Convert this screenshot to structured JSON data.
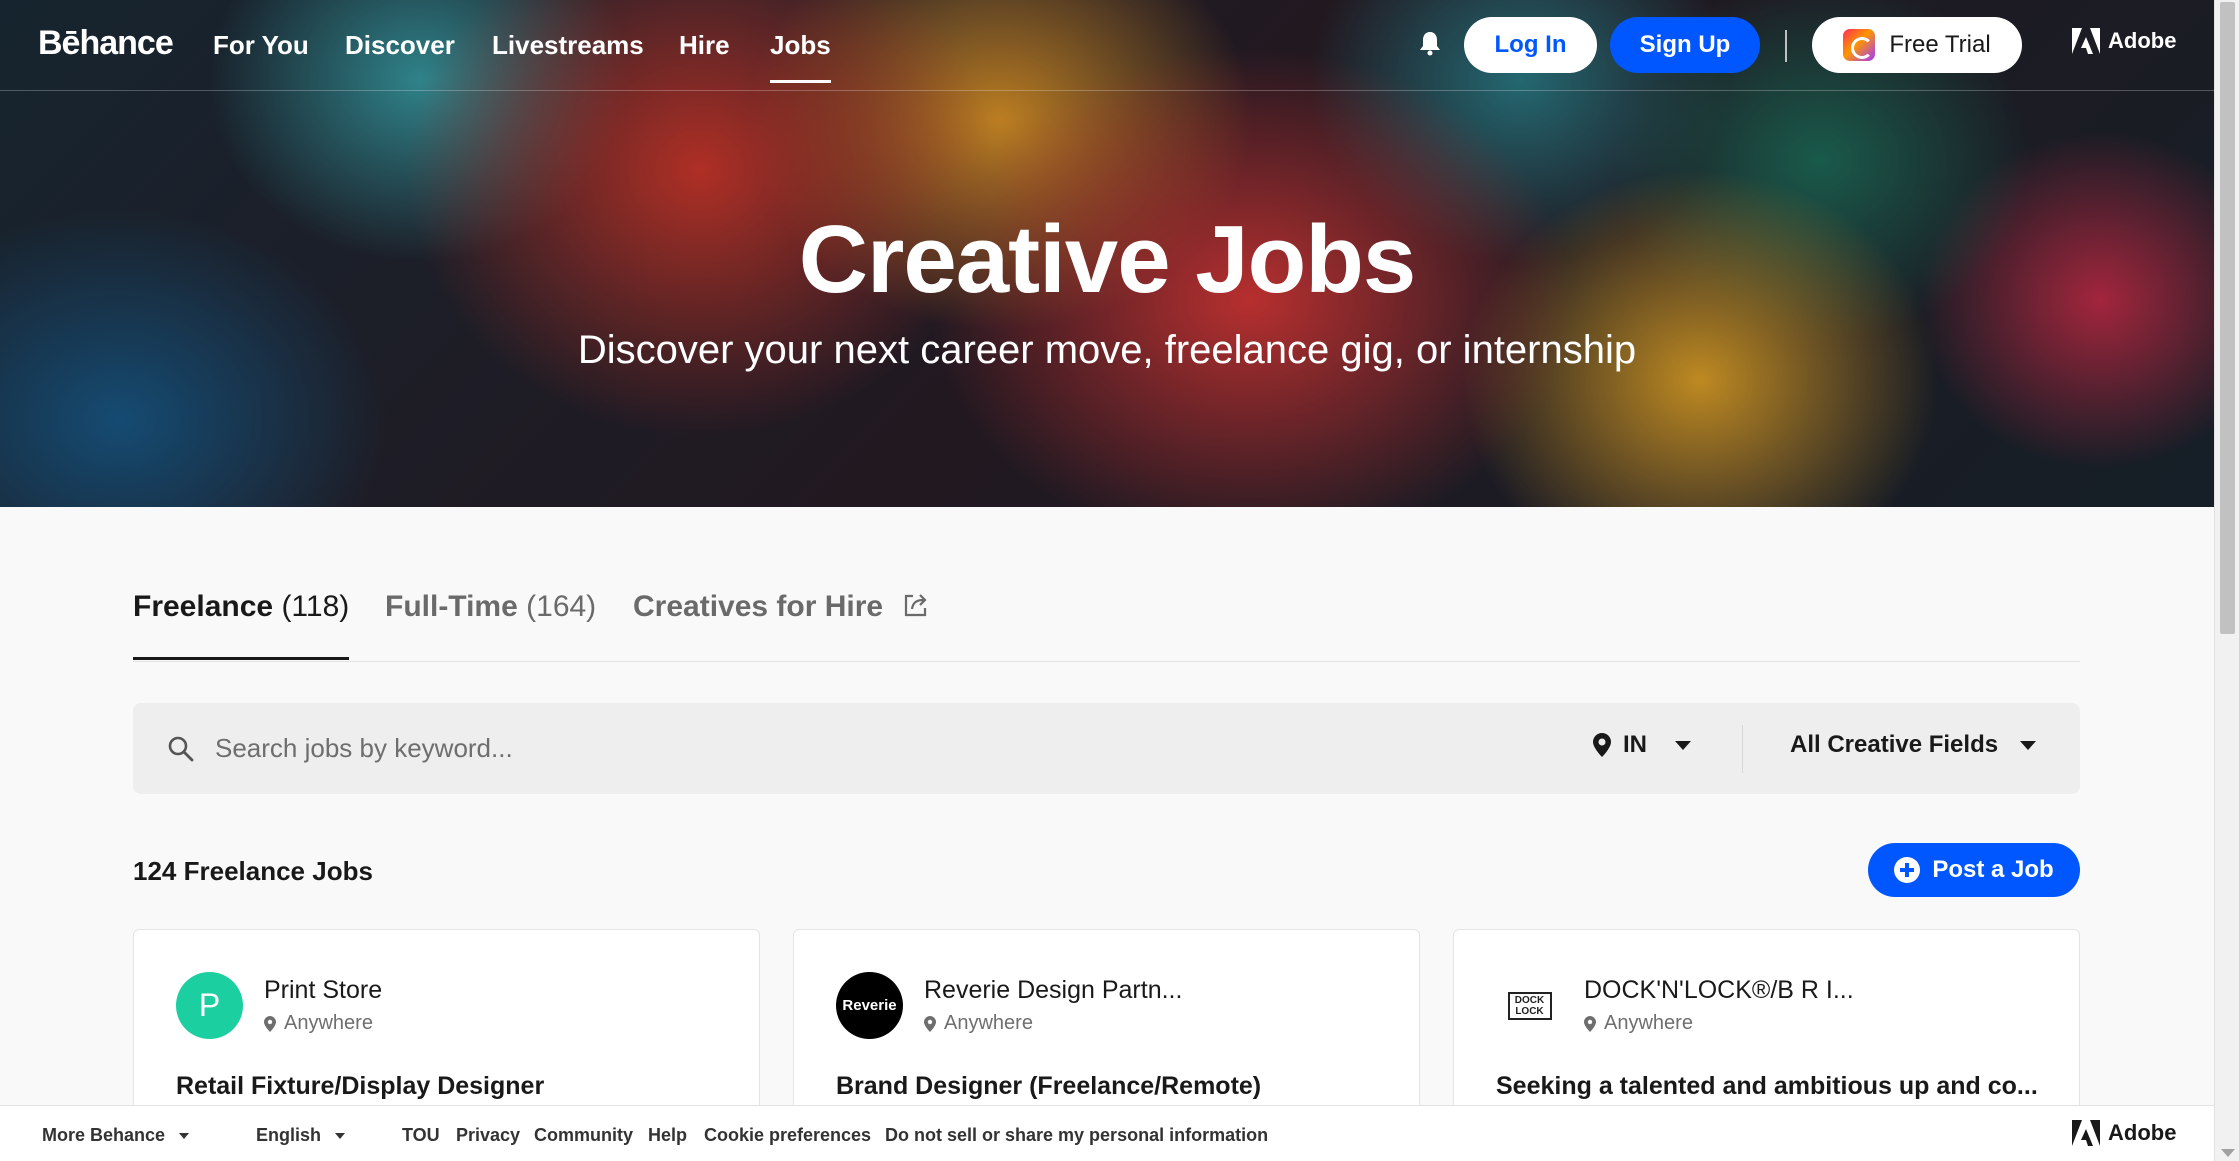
{
  "nav": {
    "logo": "Bēhance",
    "links": [
      "For You",
      "Discover",
      "Livestreams",
      "Hire",
      "Jobs"
    ],
    "login": "Log In",
    "signup": "Sign Up",
    "trial": "Free Trial",
    "adobe": "Adobe"
  },
  "hero": {
    "title": "Creative Jobs",
    "subtitle": "Discover your next career move, freelance gig, or internship"
  },
  "tabs": [
    {
      "label": "Freelance",
      "count": "(118)"
    },
    {
      "label": "Full-Time",
      "count": "(164)"
    },
    {
      "label": "Creatives for Hire"
    }
  ],
  "search": {
    "placeholder": "Search jobs by keyword...",
    "location": "IN",
    "fields": "All Creative Fields"
  },
  "results": {
    "count_label": "124 Freelance Jobs",
    "post_button": "Post a Job"
  },
  "cards": [
    {
      "logo_text": "P",
      "company": "Print Store",
      "location": "Anywhere",
      "title": "Retail Fixture/Display Designer"
    },
    {
      "logo_text": "Reverie",
      "company": "Reverie Design Partn...",
      "location": "Anywhere",
      "title": "Brand Designer (Freelance/Remote)"
    },
    {
      "logo_text": "DOCK LOCK",
      "company": "DOCK'N'LOCK®/B R I...",
      "location": "Anywhere",
      "title": "Seeking a talented and ambitious up and co..."
    }
  ],
  "footer": {
    "more": "More Behance",
    "language": "English",
    "links": [
      "TOU",
      "Privacy",
      "Community",
      "Help",
      "Cookie preferences",
      "Do not sell or share my personal information"
    ],
    "adobe": "Adobe"
  },
  "colors": {
    "primary_blue": "#0057ff",
    "print_store_green": "#1ccfa0"
  }
}
